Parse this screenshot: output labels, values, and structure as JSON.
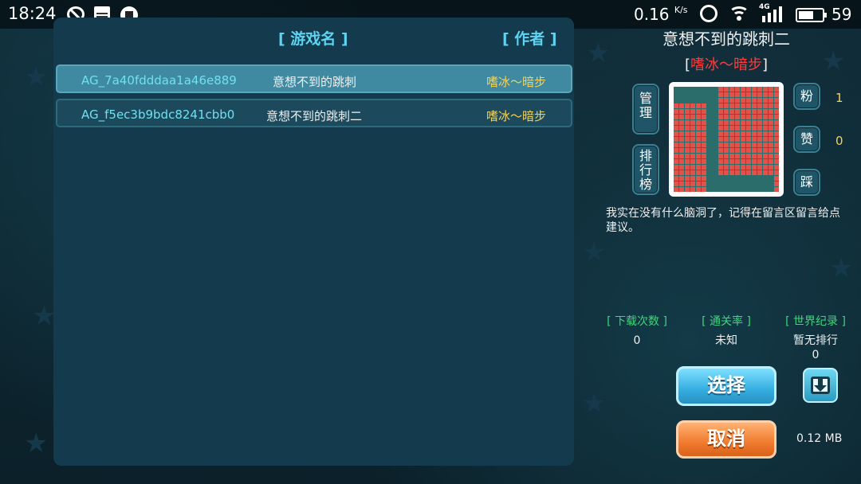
{
  "status_bar": {
    "time": "18:24",
    "speed": "0.16",
    "speed_unit": "K/s",
    "network": "4G",
    "battery": "59",
    "icons": [
      "block-icon",
      "news-icon",
      "shirt-icon",
      "alarm-icon",
      "wifi-icon",
      "signal-icon",
      "battery-icon"
    ]
  },
  "list": {
    "header_name": "[ 游戏名 ]",
    "header_author": "[ 作者 ]",
    "rows": [
      {
        "id": "AG_7a40fdddaa1a46e889",
        "name": "意想不到的跳刺",
        "author": "嗜冰～暗步",
        "selected": true
      },
      {
        "id": "AG_f5ec3b9bdc8241cbb0",
        "name": "意想不到的跳刺二",
        "author": "嗜冰～暗步",
        "selected": false
      }
    ]
  },
  "detail": {
    "title": "意想不到的跳刺二",
    "author_open": "[",
    "author": "嗜冰～暗步",
    "author_close": "]",
    "manage_label": "管理",
    "ranking_label": "排行榜",
    "fans_label": "粉",
    "fans_count": "1",
    "like_label": "赞",
    "like_count": "0",
    "dislike_label": "踩",
    "description": "我实在没有什么脑洞了，记得在留言区留言给点建议。",
    "stats": {
      "downloads_label": "[ 下载次数 ]",
      "downloads_value": "0",
      "clear_rate_label": "[ 通关率 ]",
      "clear_rate_value": "未知",
      "record_label": "[ 世界纪录 ]",
      "record_value": "暂无排行",
      "record_value2": "0"
    },
    "select_label": "选择",
    "cancel_label": "取消",
    "file_size": "0.12 MB"
  },
  "colors": {
    "accent_header": "#5fd3f2",
    "id_text": "#6fe0f0",
    "author_text": "#f5d25a",
    "author_highlight": "#ff3b3b",
    "stat_label": "#3dd67a",
    "select_button": "#36aee0",
    "cancel_button": "#f07a2e"
  }
}
